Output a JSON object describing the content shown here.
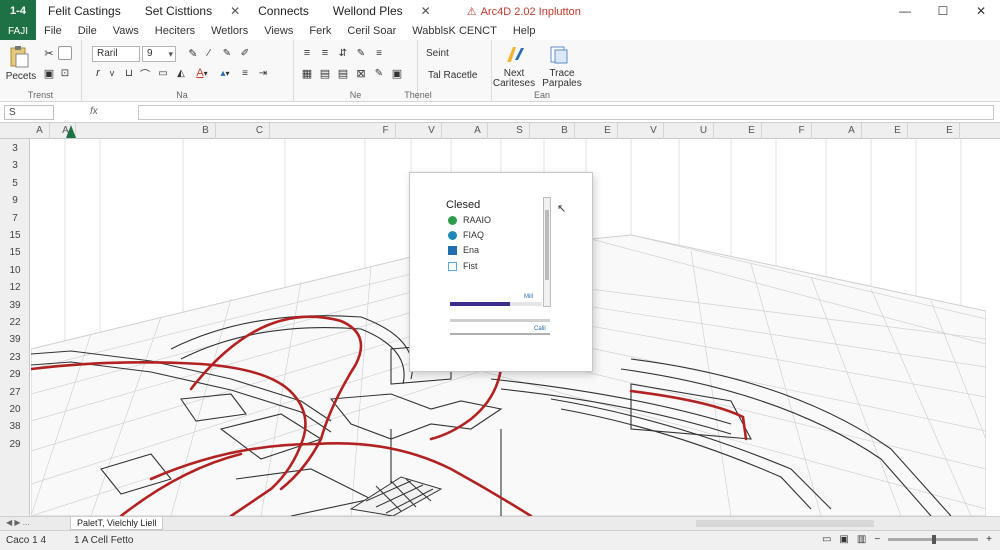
{
  "app": {
    "badge": "1-4",
    "tabs": [
      "Felit Castings",
      "Set Cisttions",
      "Connects",
      "Wellond Ples"
    ],
    "close_x": "✕",
    "title": "Arc4D 2.02 Inplutton",
    "warn": "⚠"
  },
  "window_controls": [
    "—",
    "☐",
    "✕"
  ],
  "menu": {
    "file_badge": "FAJI",
    "items": [
      "File",
      "Dile",
      "Vaws",
      "Heciters",
      "Wetlors",
      "Views",
      "Ferk",
      "Ceril Soar",
      "WabblsK CENCT",
      "Help"
    ]
  },
  "ribbon": {
    "paste_label": "Pecets",
    "group_labels": [
      "Trenst",
      "Na",
      "Ne",
      "Thenel",
      "Ean"
    ],
    "font_name": "Raril",
    "font_size": "9",
    "find_label": "Seint",
    "replace_label": "Tal Racetle",
    "next_label": "Next Cariteses",
    "trace_label": "Trace Parpales"
  },
  "formula_bar": {
    "namebox": "S",
    "fx": "fx",
    "value": ""
  },
  "columns": [
    "A",
    "A",
    "B",
    "C",
    "F",
    "V",
    "A",
    "S",
    "B",
    "E",
    "V",
    "U",
    "E",
    "F",
    "A",
    "E",
    "E"
  ],
  "rows": [
    "3",
    "3",
    "5",
    "9",
    "7",
    "15",
    "15",
    "10",
    "12",
    "39",
    "22",
    "39",
    "23",
    "29",
    "27",
    "20",
    "38",
    "29"
  ],
  "dialog": {
    "title": "Clesed",
    "options": [
      "RAAIO",
      "FIAQ",
      "Ena",
      "Fist"
    ],
    "option_colors": [
      "#2e9d4a",
      "#1e88b8",
      "#1f6fb0",
      "#5aa9d6"
    ],
    "progress_label": "Mill",
    "progress_pct": 65,
    "slider_label": "Calil"
  },
  "sheet": {
    "nav": "◀ ▶ ...",
    "tab": "PaletT, Vielchly Liell"
  },
  "status": {
    "left": "Caco 1 4",
    "mid": "1 A Cell Fetto",
    "zoom_minus": "−",
    "zoom_plus": "+"
  },
  "colors": {
    "brand": "#1e7145",
    "road": "#b22222",
    "grid": "#c8c8c8"
  }
}
